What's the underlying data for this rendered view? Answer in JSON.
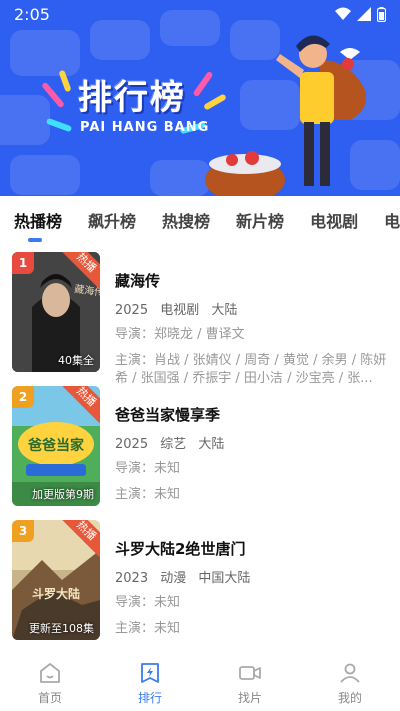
{
  "status_bar": {
    "time": "2:05"
  },
  "banner": {
    "title": "排行榜",
    "subtitle": "PAI HANG BANG"
  },
  "tabs": [
    {
      "label": "热播榜",
      "active": true
    },
    {
      "label": "飙升榜",
      "active": false
    },
    {
      "label": "热搜榜",
      "active": false
    },
    {
      "label": "新片榜",
      "active": false
    },
    {
      "label": "电视剧",
      "active": false
    },
    {
      "label": "电影",
      "active": false
    }
  ],
  "items": [
    {
      "rank": "1",
      "rank_color": "#e84a3f",
      "badge": "热播",
      "poster_caption": "40集全",
      "poster_text": "藏海传",
      "title": "藏海传",
      "year": "2025",
      "genre": "电视剧",
      "region": "大陆",
      "director_label": "导演：",
      "director": "郑晓龙 / 曹译文",
      "cast_label": "主演：",
      "cast": "肖战 / 张婧仪 / 周奇 / 黄觉 / 余男 / 陈妍希 / 张国强 / 乔振宇 / 田小洁 / 沙宝亮 / 张..."
    },
    {
      "rank": "2",
      "rank_color": "#f0a020",
      "badge": "热播",
      "poster_caption": "加更版第9期",
      "poster_text": "爸爸当家",
      "title": "爸爸当家慢享季",
      "year": "2025",
      "genre": "综艺",
      "region": "大陆",
      "director_label": "导演：",
      "director": "未知",
      "cast_label": "主演：",
      "cast": "未知"
    },
    {
      "rank": "3",
      "rank_color": "#f0a020",
      "badge": "热播",
      "poster_caption": "更新至108集",
      "poster_text": "斗罗大陆",
      "title": "斗罗大陆2绝世唐门",
      "year": "2023",
      "genre": "动漫",
      "region": "中国大陆",
      "director_label": "导演：",
      "director": "未知",
      "cast_label": "主演：",
      "cast": "未知"
    }
  ],
  "bottom_nav": [
    {
      "label": "首页",
      "icon": "home-icon",
      "active": false
    },
    {
      "label": "排行",
      "icon": "ranking-icon",
      "active": true
    },
    {
      "label": "找片",
      "icon": "video-camera-icon",
      "active": false
    },
    {
      "label": "我的",
      "icon": "user-icon",
      "active": false
    }
  ],
  "colors": {
    "accent": "#3a7bf0",
    "banner_bg": "#2f5ff0",
    "hot_badge": "#e8573a"
  }
}
